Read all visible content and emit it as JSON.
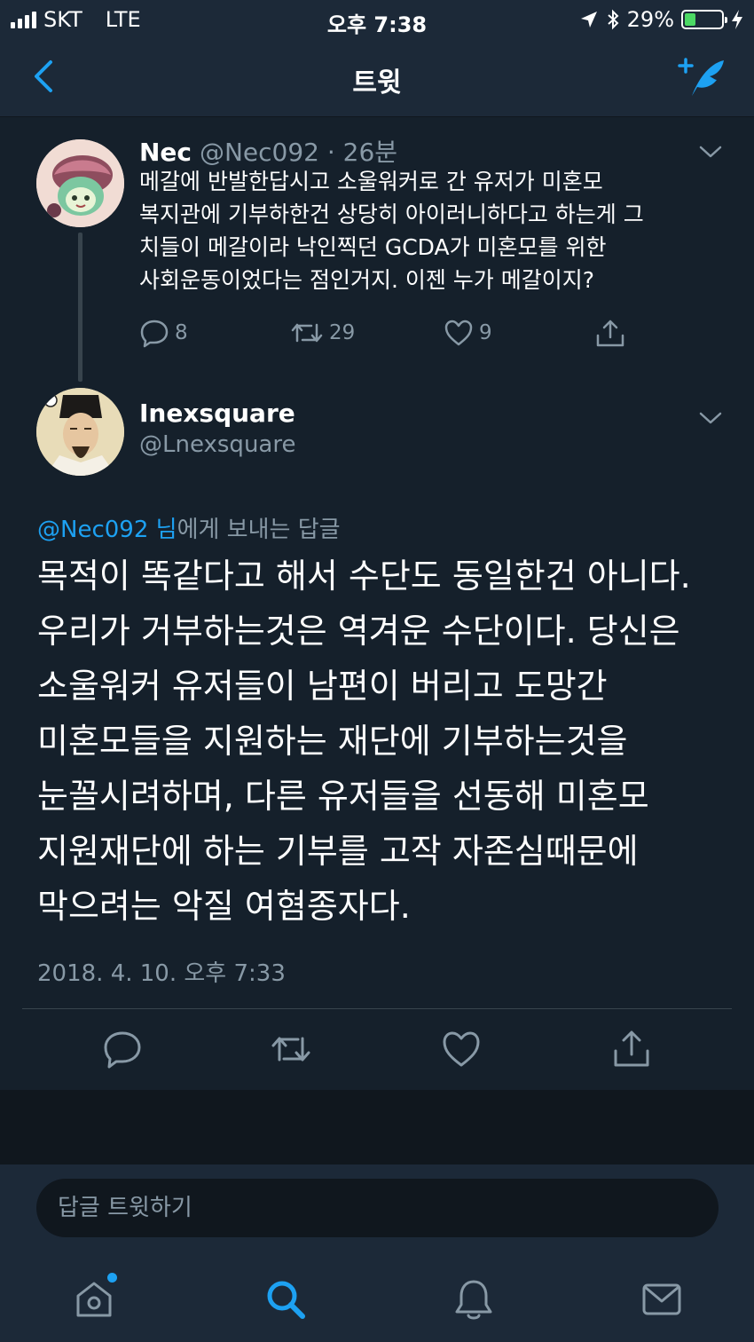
{
  "status_bar": {
    "carrier": "SKT",
    "network": "LTE",
    "time": "오후 7:38",
    "battery_percent": "29%",
    "battery_level": 0.29
  },
  "nav": {
    "title": "트윗",
    "back_icon": "chevron-left-icon",
    "compose_icon": "compose-tweet-icon"
  },
  "parent_tweet": {
    "name": "Nec",
    "handle": "@Nec092",
    "separator": "·",
    "time_ago": "26분",
    "lines": [
      "메갈에 반발한답시고 소울워커로 간 유저가 미혼모",
      "복지관에 기부하한건 상당히 아이러니하다고 하는게 그",
      "치들이 메갈이라 낙인찍던 GCDA가 미혼모를 위한",
      "사회운동이었다는 점인거지. 이젠 누가 메갈이지?"
    ],
    "reply_count": "8",
    "retweet_count": "29",
    "like_count": "9"
  },
  "main_tweet": {
    "name": "Inexsquare",
    "handle": "@Lnexsquare",
    "reply_mention": "@Nec092 님",
    "reply_suffix": "에게 보내는 답글",
    "lines": [
      "목적이 똑같다고 해서 수단도 동일한건 아니다.",
      "우리가 거부하는것은 역겨운 수단이다. 당신은",
      "소울워커 유저들이 남편이 버리고 도망간",
      "미혼모들을 지원하는 재단에 기부하는것을",
      "눈꼴시려하며, 다른 유저들을 선동해 미혼모",
      "지원재단에 하는 기부를 고작 자존심때문에",
      "막으려는 악질 여혐종자다."
    ],
    "timestamp": "2018. 4. 10. 오후 7:33"
  },
  "reply_bar": {
    "placeholder": "답글 트윗하기"
  },
  "tab_bar": {
    "items": [
      "home-icon",
      "search-icon",
      "notifications-icon",
      "messages-icon"
    ],
    "active": "search-icon"
  },
  "colors": {
    "background": "#15202b",
    "bar": "#1c2938",
    "accent": "#1da1f2",
    "muted": "#8899a6",
    "divider": "#38444d"
  }
}
